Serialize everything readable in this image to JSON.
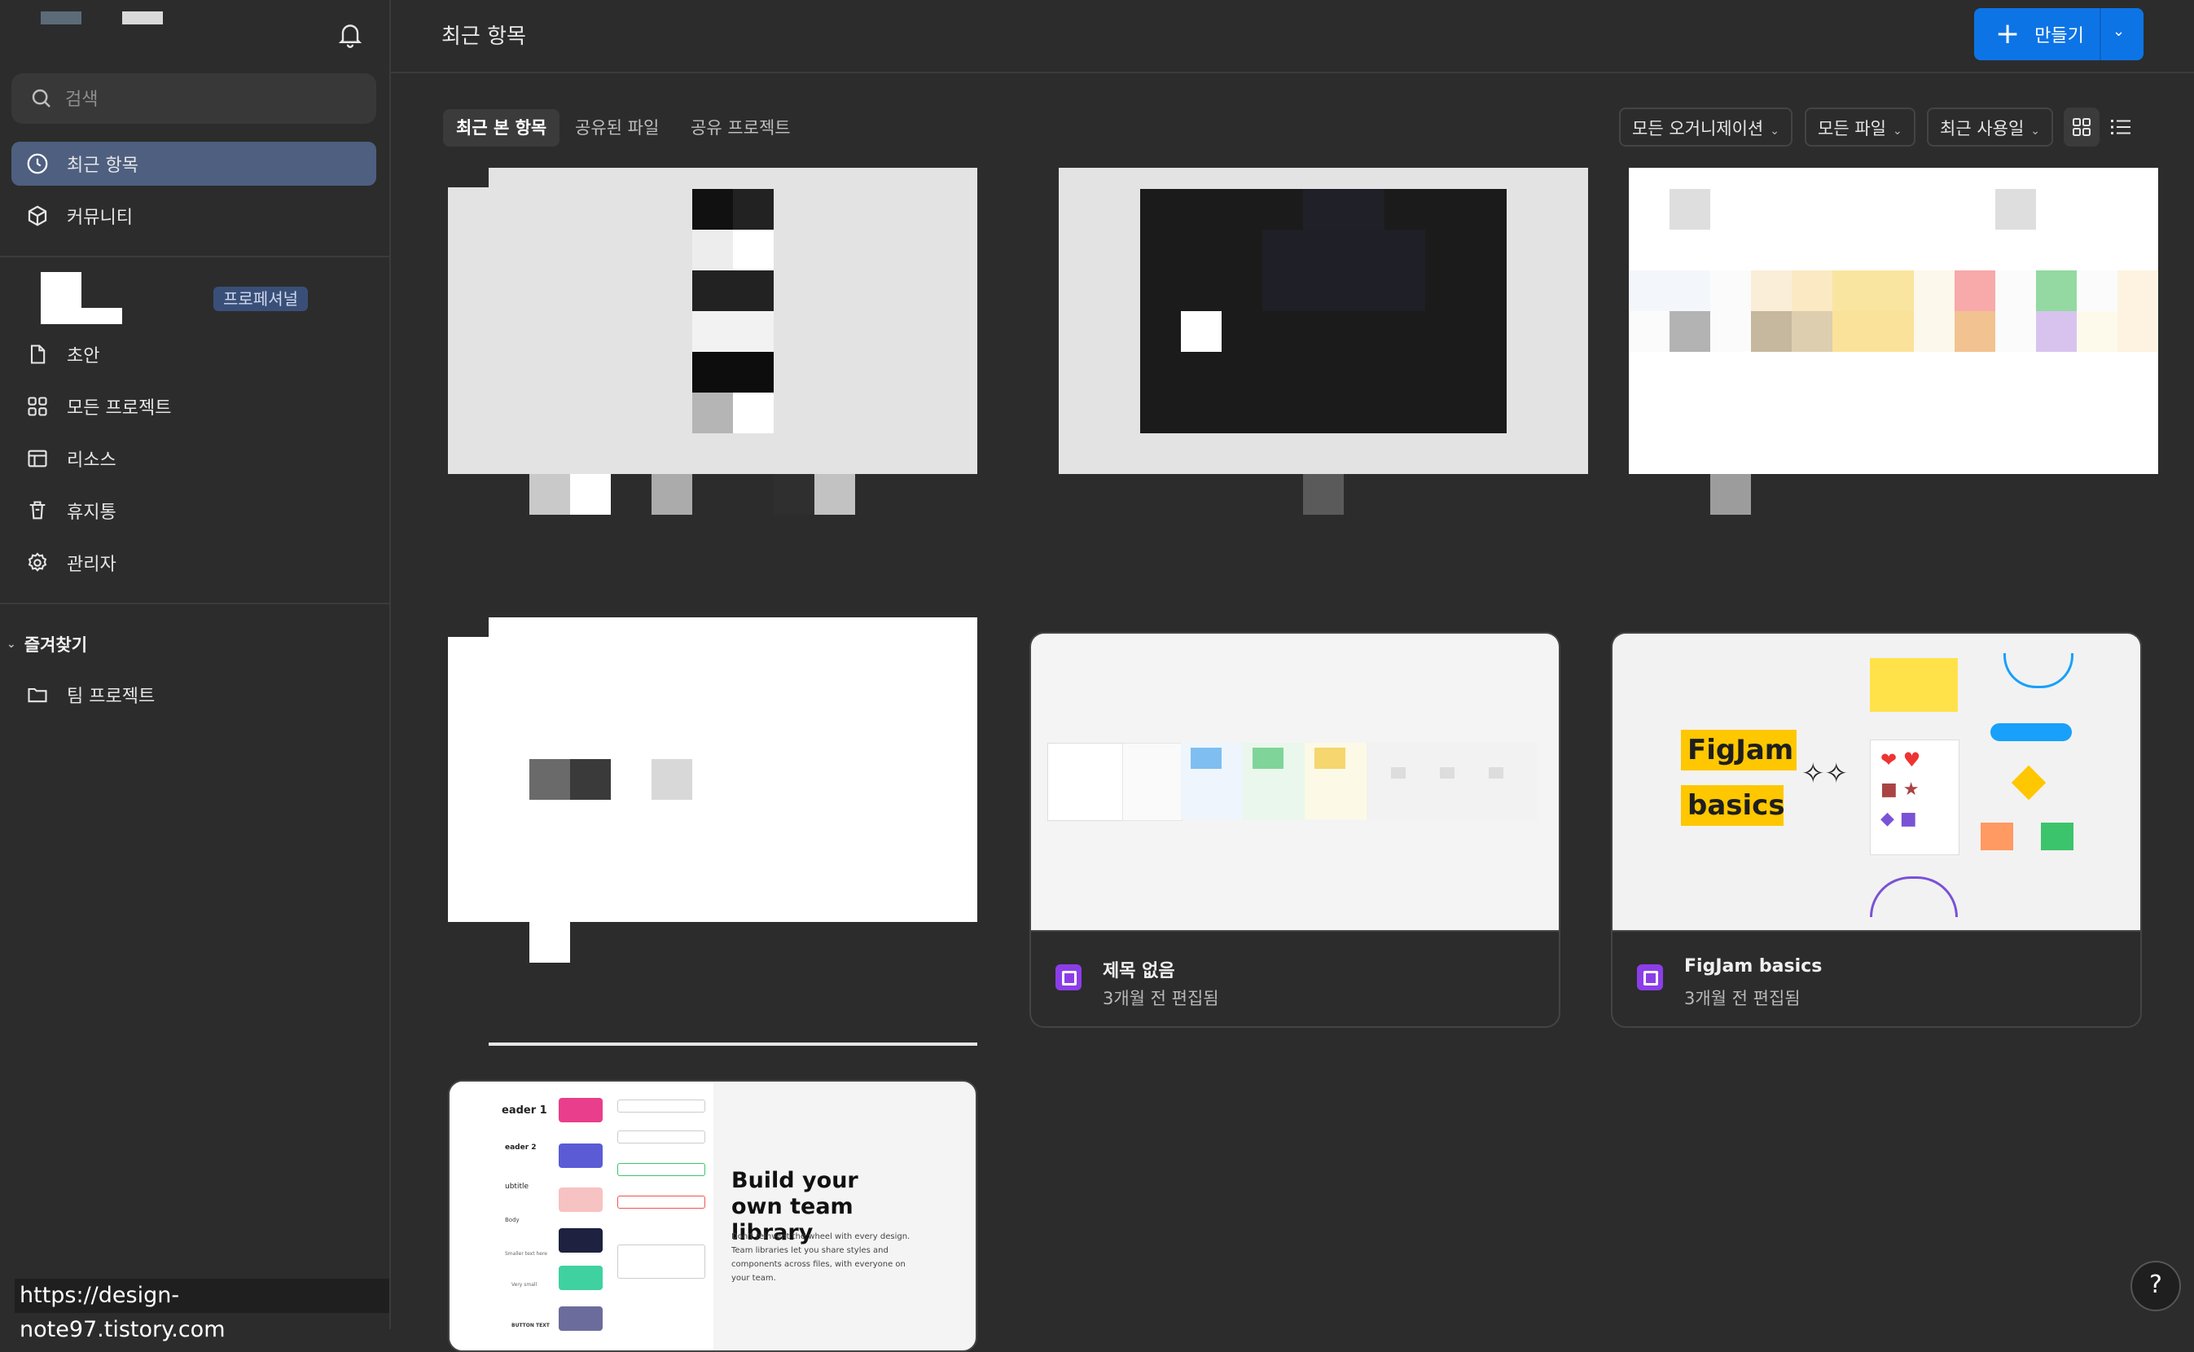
{
  "sidebar": {
    "search_placeholder": "검색",
    "primary_nav": [
      {
        "label": "최근 항목",
        "icon": "clock-icon",
        "active": true
      },
      {
        "label": "커뮤니티",
        "icon": "community-icon",
        "active": false
      }
    ],
    "org_badge": "프로페셔널",
    "team_nav": [
      {
        "label": "초안",
        "icon": "file-icon"
      },
      {
        "label": "모든 프로젝트",
        "icon": "grid-icon"
      },
      {
        "label": "리소스",
        "icon": "library-icon"
      },
      {
        "label": "휴지통",
        "icon": "trash-icon"
      },
      {
        "label": "관리자",
        "icon": "gear-icon"
      }
    ],
    "favorites_label": "즐겨찾기",
    "favorites": [
      {
        "label": "팀 프로젝트",
        "icon": "folder-icon"
      }
    ]
  },
  "header": {
    "title": "최근 항목",
    "create_label": "만들기"
  },
  "tabs": [
    "최근 본 항목",
    "공유된 파일",
    "공유 프로젝트"
  ],
  "filters": {
    "organization": "모든 오거니제이션",
    "files": "모든 파일",
    "sort": "최근 사용일"
  },
  "files": [
    {
      "name": "제목 없음",
      "edited": "3개월 전 편집됨",
      "type": "figjam"
    },
    {
      "name": "FigJam basics",
      "edited": "3개월 전 편집됨",
      "type": "figjam",
      "preview_text": [
        "FigJam",
        "basics"
      ]
    }
  ],
  "library_preview": {
    "title": "Build your own team library",
    "body": "Don't reinvent the wheel with every design. Team libraries let you share styles and components across files, with everyone on your team.",
    "side_labels": [
      "eader 1",
      "eader 2",
      "ubtitle",
      "Body",
      "Smaller text here",
      "Very small",
      "BUTTON TEXT"
    ]
  },
  "watermark": "https://design-note97.tistory.com",
  "help_label": "?",
  "colors": {
    "accent": "#0d74e6",
    "active_nav": "#4e5f80",
    "figjam_icon": "#8b3ee8",
    "figjam_yellow": "#ffc700"
  }
}
